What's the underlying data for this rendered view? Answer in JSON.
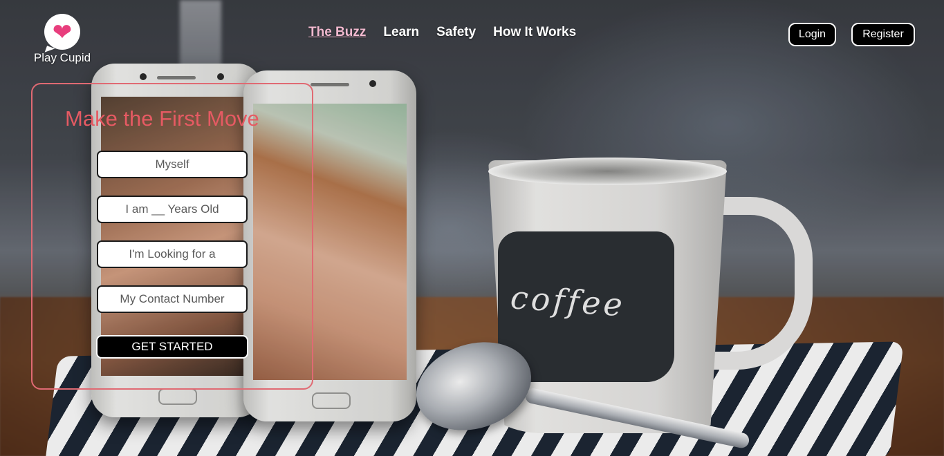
{
  "brand": {
    "name": "Play Cupid",
    "logo_icon": "heart-chat-icon",
    "accent": "#e83e7d"
  },
  "nav": {
    "items": [
      {
        "label": "The Buzz",
        "active": true
      },
      {
        "label": "Learn",
        "active": false
      },
      {
        "label": "Safety",
        "active": false
      },
      {
        "label": "How It Works",
        "active": false
      }
    ]
  },
  "auth": {
    "login_label": "Login",
    "register_label": "Register"
  },
  "form": {
    "title": "Make the First Move",
    "title_color": "#e65a63",
    "fields": [
      {
        "placeholder": "Myself"
      },
      {
        "placeholder": "I am __ Years Old"
      },
      {
        "placeholder": "I'm Looking for a"
      },
      {
        "placeholder": "My Contact Number"
      }
    ],
    "submit_label": "GET STARTED"
  },
  "hero": {
    "mug_text": "coffee"
  }
}
